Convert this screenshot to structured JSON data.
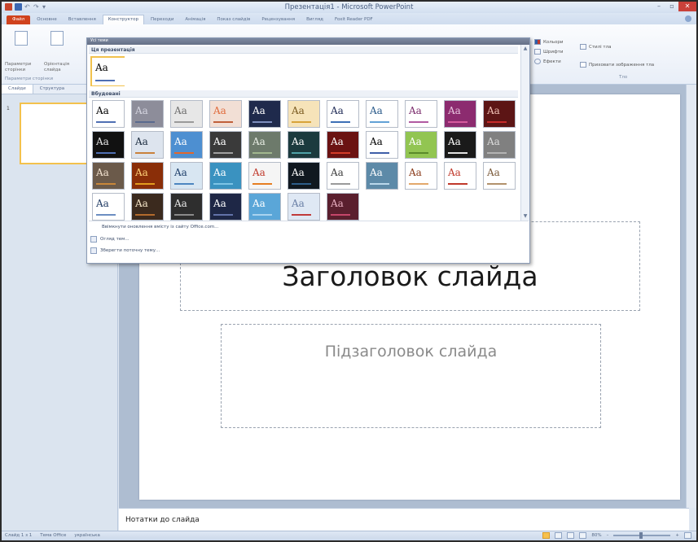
{
  "window": {
    "title": "Презентація1 - Microsoft PowerPoint",
    "minimize": "–",
    "maximize": "▫",
    "close": "✕"
  },
  "tabs": [
    "Файл",
    "Основне",
    "Вставлення",
    "Конструктор",
    "Переходи",
    "Анімація",
    "Показ слайдів",
    "Рецензування",
    "Вигляд",
    "Foxit Reader PDF"
  ],
  "ribbon": {
    "page_setup": "Параметри сторінки",
    "orientation": "Орієнтація слайда",
    "group_page_setup": "Параметри сторінки",
    "colors": "Кольори",
    "fonts": "Шрифти",
    "effects": "Ефекти",
    "bg_styles": "Стилі тла",
    "hide_bg": "Приховати зображення тла",
    "group_background": "Тло"
  },
  "left_pane": {
    "tab_slides": "Слайди",
    "tab_outline": "Структура",
    "slide_number": "1"
  },
  "slide": {
    "title_placeholder": "Заголовок слайда",
    "subtitle_placeholder": "Підзаголовок слайда"
  },
  "notes_placeholder": "Нотатки до слайда",
  "status": {
    "slide_info": "Слайд 1 з 1",
    "theme": "Тема Office",
    "language": "українська",
    "zoom": "80%",
    "zoom_out": "–",
    "zoom_in": "+"
  },
  "gallery": {
    "header": "Усі теми",
    "section_current": "Ця презентація",
    "section_builtin": "Вбудовані",
    "tile_text": "Aa",
    "cmd_online": "Ввімкнути оновлення вмісту із сайту Office.com...",
    "cmd_browse": "Огляд тем...",
    "cmd_save": "Зберегти поточну тему...",
    "scroll_up": "▲",
    "scroll_down": "▼"
  },
  "themes_current": [
    {
      "bg": "#ffffff",
      "fg": "#000000",
      "bar": "#4f6fb3"
    }
  ],
  "themes_builtin": [
    {
      "bg": "#ffffff",
      "fg": "#000000",
      "bar": "#4f6fb3"
    },
    {
      "bg": "#8d8d9a",
      "fg": "#d5d5e0",
      "bar": "#5a6a8e"
    },
    {
      "bg": "#e7e7e7",
      "fg": "#6e6e6e",
      "bar": "#9a9a9a"
    },
    {
      "bg": "#f2dfd5",
      "fg": "#e06b3c",
      "bar": "#c0603a"
    },
    {
      "bg": "#1f2a4c",
      "fg": "#ffffff",
      "bar": "#7d8dbd"
    },
    {
      "bg": "#f6e3b9",
      "fg": "#7a5a20",
      "bar": "#d8a33a"
    },
    {
      "bg": "#ffffff",
      "fg": "#1e2a55",
      "bar": "#3d6fb6"
    },
    {
      "bg": "#ffffff",
      "fg": "#2a5a8a",
      "bar": "#62a1d6"
    },
    {
      "bg": "#ffffff",
      "fg": "#7a2a6b",
      "bar": "#b15aa1"
    },
    {
      "bg": "#8c2b6f",
      "fg": "#e8c6df",
      "bar": "#d65a9e"
    },
    {
      "bg": "#5c1515",
      "fg": "#f1c1b6",
      "bar": "#c82b2b"
    },
    {
      "bg": "#111111",
      "fg": "#e6e6e6",
      "bar": "#4f6fb3"
    },
    {
      "bg": "#dde4ee",
      "fg": "#1a2a3d",
      "bar": "#c9813c"
    },
    {
      "bg": "#4d8fd1",
      "fg": "#ffffff",
      "bar": "#e2672b"
    },
    {
      "bg": "#3a3a3a",
      "fg": "#ffffff",
      "bar": "#a0a0a0"
    },
    {
      "bg": "#6d7a6b",
      "fg": "#e8ede4",
      "bar": "#a1b78e"
    },
    {
      "bg": "#1b3a3e",
      "fg": "#ffffff",
      "bar": "#4fa2a8"
    },
    {
      "bg": "#6b1212",
      "fg": "#ffffff",
      "bar": "#d33c2a"
    },
    {
      "bg": "#ffffff",
      "fg": "#000000",
      "bar": "#3e5ea8"
    },
    {
      "bg": "#92c552",
      "fg": "#ffffff",
      "bar": "#5a8a2a"
    },
    {
      "bg": "#1a1a1a",
      "fg": "#ffffff",
      "bar": "#e2e2e2"
    },
    {
      "bg": "#808080",
      "fg": "#dcdcdc",
      "bar": "#b3b3b3"
    },
    {
      "bg": "#6b5a4a",
      "fg": "#f2e2cf",
      "bar": "#c8873a"
    },
    {
      "bg": "#8a2e08",
      "fg": "#ffd27a",
      "bar": "#e39c1e"
    },
    {
      "bg": "#d8e6f2",
      "fg": "#1f3f6a",
      "bar": "#4d86c0"
    },
    {
      "bg": "#3a92c0",
      "fg": "#ffffff",
      "bar": "#7dc4e6"
    },
    {
      "bg": "#f5f5f5",
      "fg": "#c0392b",
      "bar": "#e67e22"
    },
    {
      "bg": "#101820",
      "fg": "#ffffff",
      "bar": "#2e5e8a"
    },
    {
      "bg": "#ffffff",
      "fg": "#3c3c3c",
      "bar": "#9a9a9a"
    },
    {
      "bg": "#5d8aa8",
      "fg": "#ffffff",
      "bar": "#b9d7ea"
    },
    {
      "bg": "#ffffff",
      "fg": "#8a3b1a",
      "bar": "#e3a86b"
    },
    {
      "bg": "#ffffff",
      "fg": "#c0392b",
      "bar": "#c0392b"
    },
    {
      "bg": "#ffffff",
      "fg": "#7a5a3a",
      "bar": "#b2926c"
    },
    {
      "bg": "#ffffff",
      "fg": "#1f3a63",
      "bar": "#6c8ec2"
    },
    {
      "bg": "#3b2a1e",
      "fg": "#f5e6c8",
      "bar": "#b36a2c"
    },
    {
      "bg": "#2e2e2e",
      "fg": "#e8e8e8",
      "bar": "#8a8a8a"
    },
    {
      "bg": "#1e2746",
      "fg": "#ffffff",
      "bar": "#6272a8"
    },
    {
      "bg": "#5aa6d8",
      "fg": "#ffffff",
      "bar": "#a9d3ef"
    },
    {
      "bg": "#dfe8f4",
      "fg": "#6a7fa6",
      "bar": "#c03a3a"
    },
    {
      "bg": "#5a1f2e",
      "fg": "#e8aec0",
      "bar": "#c4466a"
    }
  ]
}
